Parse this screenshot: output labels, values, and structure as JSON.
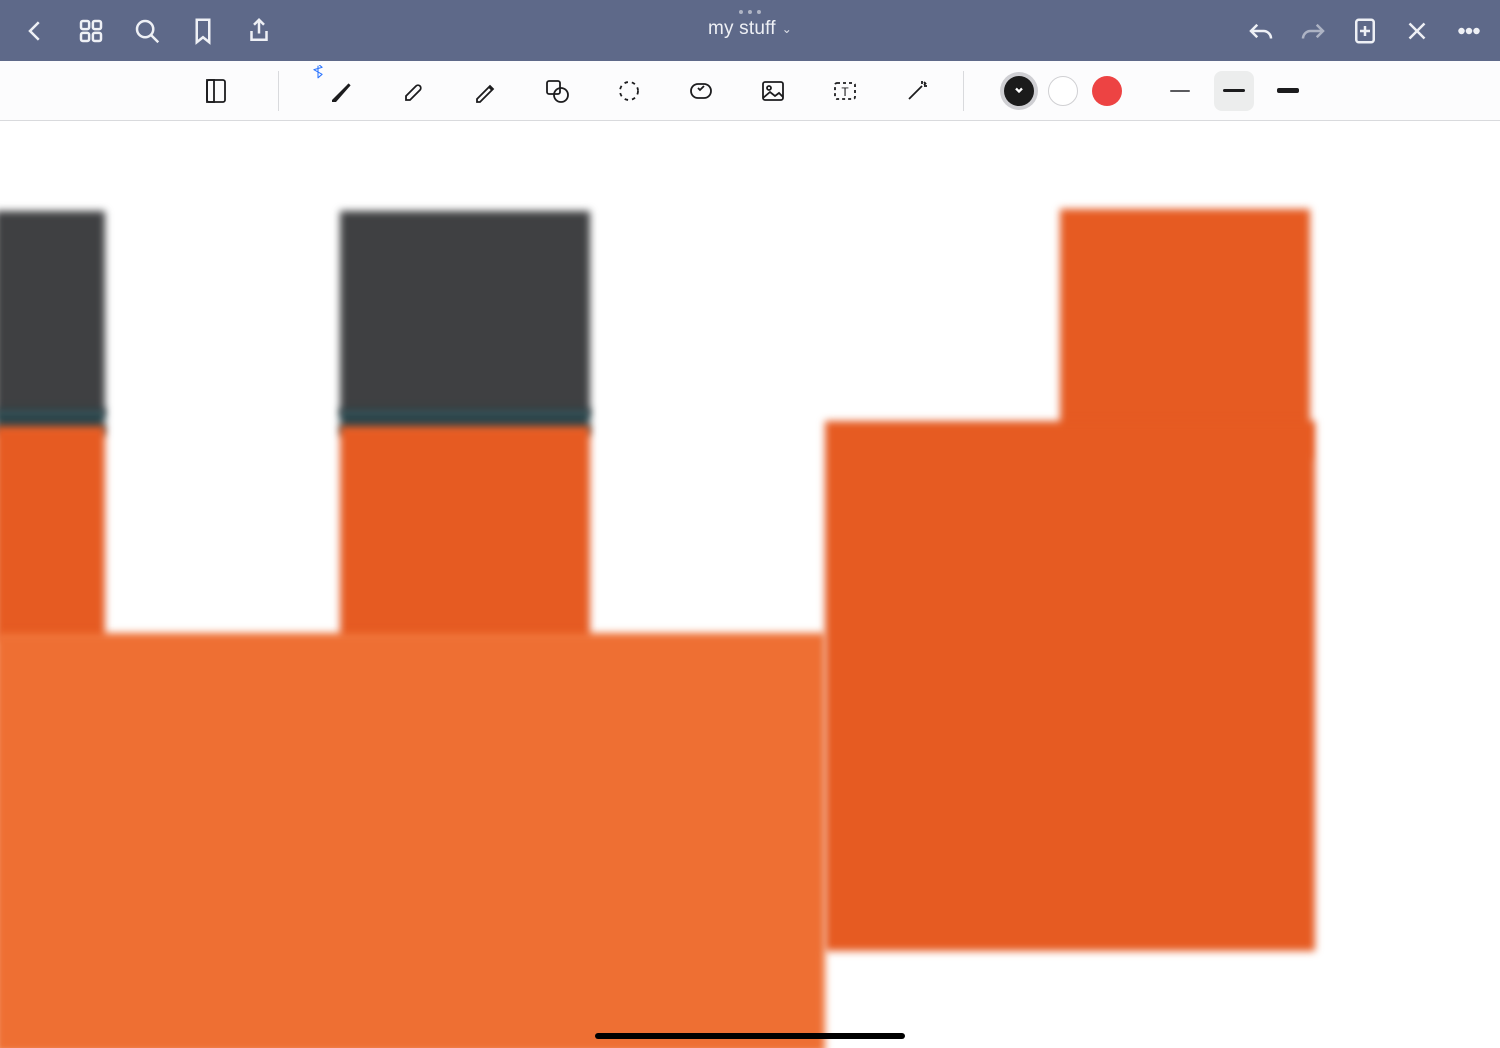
{
  "header": {
    "title": "my stuff",
    "icons": {
      "back": "back-icon",
      "grid": "documents-grid-icon",
      "search": "search-icon",
      "bookmark": "bookmark-icon",
      "share": "share-icon",
      "undo": "undo-icon",
      "redo": "redo-icon",
      "add_page": "add-page-icon",
      "close_toolbar": "close-toolbar-icon",
      "more": "more-icon"
    }
  },
  "toolbar": {
    "tools": [
      {
        "name": "page-template-tool",
        "selected": false
      },
      {
        "name": "pen-tool",
        "selected": false,
        "bluetooth": true
      },
      {
        "name": "eraser-tool",
        "selected": false
      },
      {
        "name": "highlighter-tool",
        "selected": false
      },
      {
        "name": "shapes-tool",
        "selected": false
      },
      {
        "name": "lasso-tool",
        "selected": false
      },
      {
        "name": "sticker-tool",
        "selected": false
      },
      {
        "name": "image-tool",
        "selected": false
      },
      {
        "name": "text-tool",
        "selected": false
      },
      {
        "name": "laser-tool",
        "selected": false
      }
    ],
    "colors": [
      {
        "name": "black",
        "hex": "#1b1b1b",
        "selected": true
      },
      {
        "name": "white",
        "hex": "#ffffff",
        "selected": false
      },
      {
        "name": "red",
        "hex": "#ed4343",
        "selected": false
      }
    ],
    "strokes": [
      {
        "name": "thin",
        "selected": false
      },
      {
        "name": "medium",
        "selected": true
      },
      {
        "name": "thick",
        "selected": false
      }
    ]
  },
  "canvas": {
    "colors": {
      "dark_gray": "#3f4042",
      "dark_teal": "#2b454b",
      "orange": "#e65b22",
      "light_orange": "#ee6f33"
    }
  }
}
